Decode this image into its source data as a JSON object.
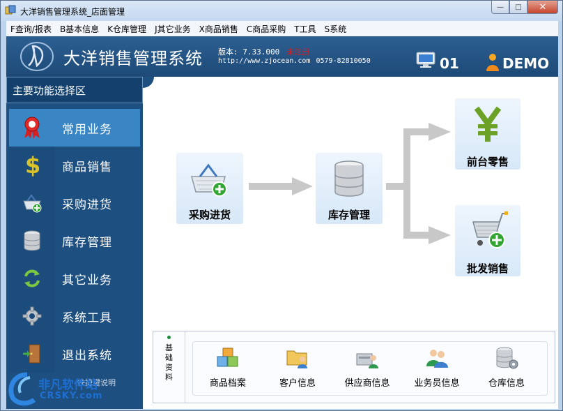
{
  "window": {
    "title": "大洋销售管理系统_店面管理",
    "buttons": {
      "minimize": "—",
      "maximize": "□",
      "close": "✕"
    }
  },
  "menu": [
    "F查询/报表",
    "B基本信息",
    "K仓库管理",
    "J其它业务",
    "X商品销售",
    "C商品采购",
    "T工具",
    "S系统"
  ],
  "header": {
    "app_name": "大洋销售管理系统",
    "version": "版本: 7.33.000",
    "reg_status": "未注册",
    "url": "http://www.zjocean.com",
    "phone": "0579-82810050",
    "station": "01",
    "user": "DEMO"
  },
  "sidebar": {
    "title": "主要功能选择区",
    "items": [
      {
        "label": "常用业务",
        "icon": "ribbon-award-icon"
      },
      {
        "label": "商品销售",
        "icon": "dollar-icon"
      },
      {
        "label": "采购进货",
        "icon": "basket-add-icon"
      },
      {
        "label": "库存管理",
        "icon": "database-icon"
      },
      {
        "label": "其它业务",
        "icon": "refresh-arrows-icon"
      },
      {
        "label": "系统工具",
        "icon": "gear-icon"
      },
      {
        "label": "退出系统",
        "icon": "exit-door-icon"
      }
    ],
    "help_text": "快捷键说明"
  },
  "flow": {
    "purchase": "采购进货",
    "inventory": "库存管理",
    "retail": "前台零售",
    "wholesale": "批发销售"
  },
  "basic": {
    "tag": "基础资料",
    "items": [
      {
        "label": "商品档案",
        "icon": "boxes-icon"
      },
      {
        "label": "客户信息",
        "icon": "folder-user-icon"
      },
      {
        "label": "供应商信息",
        "icon": "supplier-icon"
      },
      {
        "label": "业务员信息",
        "icon": "users-icon"
      },
      {
        "label": "仓库信息",
        "icon": "database-gear-icon"
      }
    ]
  },
  "watermark": {
    "cn": "非凡软件站",
    "en": "CRSKY.com"
  },
  "colors": {
    "header_bg": "#1d4a78",
    "sidebar_bg": "#1d4f80",
    "active_item": "#3a86c4",
    "arrow": "#c8c8c8",
    "reg_red": "#e21a1a"
  }
}
